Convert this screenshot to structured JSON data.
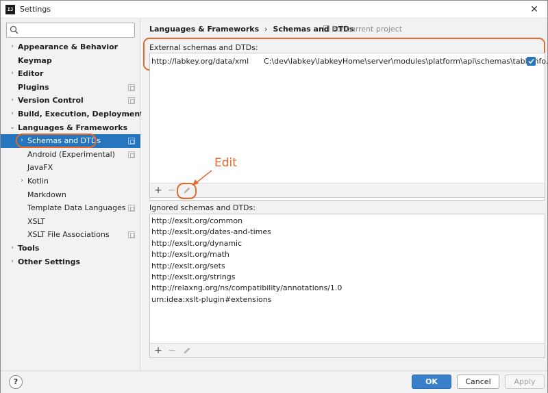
{
  "window": {
    "title": "Settings",
    "app_icon_text": "IJ"
  },
  "search": {
    "placeholder": "",
    "value": ""
  },
  "sidebar": {
    "items": [
      {
        "label": "Appearance & Behavior",
        "bold": true,
        "arrow": "›",
        "indent": 0,
        "config": false
      },
      {
        "label": "Keymap",
        "bold": true,
        "arrow": "",
        "indent": 0,
        "config": false
      },
      {
        "label": "Editor",
        "bold": true,
        "arrow": "›",
        "indent": 0,
        "config": false
      },
      {
        "label": "Plugins",
        "bold": true,
        "arrow": "",
        "indent": 0,
        "config": true
      },
      {
        "label": "Version Control",
        "bold": true,
        "arrow": "›",
        "indent": 0,
        "config": true
      },
      {
        "label": "Build, Execution, Deployment",
        "bold": true,
        "arrow": "›",
        "indent": 0,
        "config": false
      },
      {
        "label": "Languages & Frameworks",
        "bold": true,
        "arrow": "⌄",
        "indent": 0,
        "config": false
      },
      {
        "label": "Schemas and DTDs",
        "bold": false,
        "arrow": "›",
        "indent": 1,
        "config": true,
        "selected": true
      },
      {
        "label": "Android (Experimental)",
        "bold": false,
        "arrow": "",
        "indent": 1,
        "config": true
      },
      {
        "label": "JavaFX",
        "bold": false,
        "arrow": "",
        "indent": 1,
        "config": false
      },
      {
        "label": "Kotlin",
        "bold": false,
        "arrow": "›",
        "indent": 1,
        "config": false
      },
      {
        "label": "Markdown",
        "bold": false,
        "arrow": "",
        "indent": 1,
        "config": false
      },
      {
        "label": "Template Data Languages",
        "bold": false,
        "arrow": "",
        "indent": 1,
        "config": true
      },
      {
        "label": "XSLT",
        "bold": false,
        "arrow": "",
        "indent": 1,
        "config": false
      },
      {
        "label": "XSLT File Associations",
        "bold": false,
        "arrow": "",
        "indent": 1,
        "config": true
      },
      {
        "label": "Tools",
        "bold": true,
        "arrow": "›",
        "indent": 0,
        "config": false
      },
      {
        "label": "Other Settings",
        "bold": true,
        "arrow": "›",
        "indent": 0,
        "config": false
      }
    ]
  },
  "breadcrumb": {
    "parent": "Languages & Frameworks",
    "separator": "›",
    "current": "Schemas and DTDs"
  },
  "scope_note": "For current project",
  "external": {
    "label": "External schemas and DTDs:",
    "rows": [
      {
        "uri": "http://labkey.org/data/xml",
        "path": "C:\\dev\\labkey\\labkeyHome\\server\\modules\\platform\\api\\schemas\\tableinfo.xsd",
        "checked": true
      }
    ]
  },
  "toolbar": {
    "add": "+",
    "remove": "−"
  },
  "annotation": {
    "text": "Edit"
  },
  "ignored": {
    "label": "Ignored schemas and DTDs:",
    "items": [
      "http://exslt.org/common",
      "http://exslt.org/dates-and-times",
      "http://exslt.org/dynamic",
      "http://exslt.org/math",
      "http://exslt.org/sets",
      "http://exslt.org/strings",
      "http://relaxng.org/ns/compatibility/annotations/1.0",
      "urn:idea:xslt-plugin#extensions"
    ]
  },
  "footer": {
    "help": "?",
    "ok": "OK",
    "cancel": "Cancel",
    "apply": "Apply"
  },
  "colors": {
    "accent": "#2675bf",
    "annotation": "#e16a2e",
    "ok_button": "#3a7fc9"
  }
}
